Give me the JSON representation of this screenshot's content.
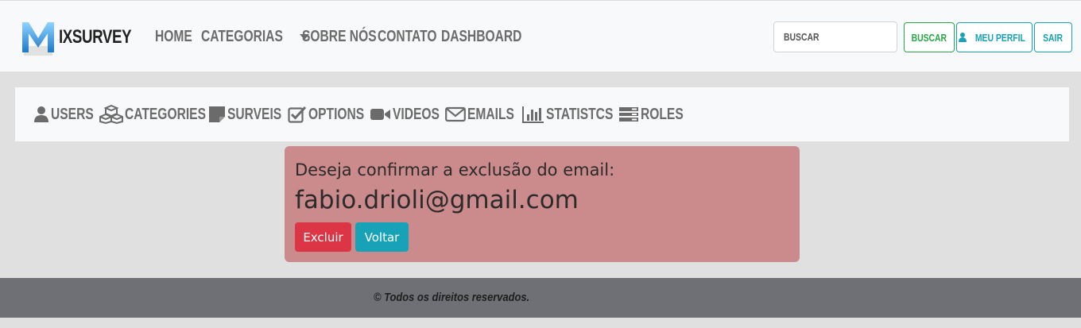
{
  "brand": {
    "letter": "M",
    "name": "IXSURVEY"
  },
  "nav": {
    "home": "HOME",
    "categorias": "CATEGORIAS",
    "sobre": "SOBRE NÓS",
    "contato": "CONTATO",
    "dashboard": "DASHBOARD"
  },
  "search": {
    "placeholder": "BUSCAR",
    "button": "BUSCAR"
  },
  "user_buttons": {
    "perfil": "MEU PERFIL",
    "sair": "SAIR"
  },
  "admin_nav": {
    "users": "USERS",
    "categories": "CATEGORIES",
    "surveis": "SURVEIS",
    "options": "OPTIONS",
    "videos": "VIDEOS",
    "emails": "EMAILS",
    "statistcs": "STATISTCS",
    "roles": "ROLES"
  },
  "alert": {
    "message": "Deseja confirmar a exclusão do email:",
    "email": "fabio.drioli@gmail.com",
    "delete_label": "Excluir",
    "back_label": "Voltar"
  },
  "footer": {
    "text": "© Todos os direitos reservados."
  },
  "colors": {
    "danger": "#dc3545",
    "info": "#17a2b8",
    "success": "#28a745",
    "alert_bg": "#cb8a8b",
    "footer_bg": "#6f7075"
  }
}
